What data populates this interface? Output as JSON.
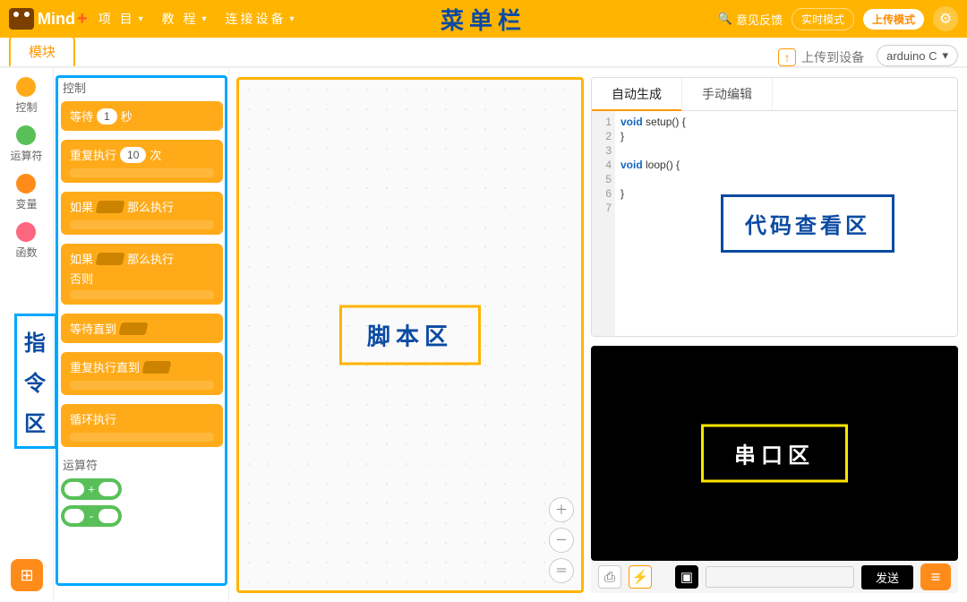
{
  "menubar": {
    "logo": "Mind",
    "logo_plus": "+",
    "items": [
      "项 目",
      "教 程",
      "连接设备"
    ],
    "annotation": "菜单栏",
    "feedback": "意见反馈",
    "mode_live": "实时模式",
    "mode_upload": "上传模式"
  },
  "subbar": {
    "tab": "模块",
    "upload_label": "上传到设备",
    "lang": "arduino C"
  },
  "categories": [
    {
      "label": "控制",
      "color": "#ffab19"
    },
    {
      "label": "运算符",
      "color": "#59c059"
    },
    {
      "label": "变量",
      "color": "#ff8c1a"
    },
    {
      "label": "函数",
      "color": "#ff6680"
    }
  ],
  "palette": {
    "section1": "控制",
    "blocks": {
      "wait_prefix": "等待",
      "wait_val": "1",
      "wait_suffix": "秒",
      "repeat_prefix": "重复执行",
      "repeat_val": "10",
      "repeat_suffix": "次",
      "if_prefix": "如果",
      "if_suffix": "那么执行",
      "ifelse_prefix": "如果",
      "ifelse_mid": "那么执行",
      "ifelse_else": "否则",
      "wait_until": "等待直到",
      "repeat_until": "重复执行直到",
      "forever": "循环执行"
    },
    "section2": "运算符",
    "op1": "+",
    "op2": "-"
  },
  "stage": {
    "annotation": "脚本区"
  },
  "code": {
    "tab_auto": "自动生成",
    "tab_manual": "手动编辑",
    "annotation": "代码查看区",
    "lines": [
      [
        {
          "t": "kw",
          "v": "void "
        },
        {
          "t": "fn",
          "v": "setup() {"
        }
      ],
      [
        {
          "t": "fn",
          "v": "}"
        }
      ],
      [
        {
          "t": "fn",
          "v": ""
        }
      ],
      [
        {
          "t": "kw",
          "v": "void "
        },
        {
          "t": "fn",
          "v": "loop() {"
        }
      ],
      [
        {
          "t": "fn",
          "v": ""
        }
      ],
      [
        {
          "t": "fn",
          "v": "}"
        }
      ],
      [
        {
          "t": "fn",
          "v": ""
        }
      ]
    ]
  },
  "serial": {
    "annotation": "串口区",
    "send": "发送"
  },
  "left_annotation": [
    "指",
    "令",
    "区"
  ]
}
